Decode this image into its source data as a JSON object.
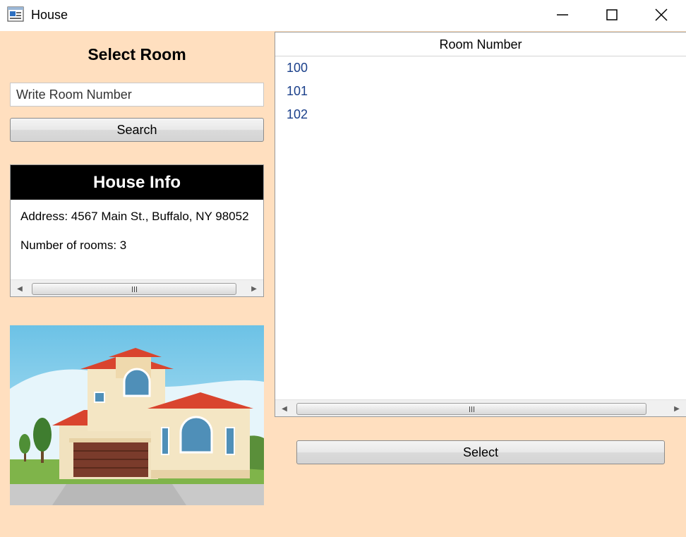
{
  "window": {
    "title": "House",
    "icon": "app-window-icon"
  },
  "left_panel": {
    "heading": "Select Room",
    "search_placeholder": "Write Room Number",
    "search_button": "Search"
  },
  "house_info": {
    "header": "House Info",
    "address": "Address: 4567 Main St., Buffalo, NY 98052",
    "rooms": "Number of rooms: 3"
  },
  "room_list": {
    "column_header": "Room Number",
    "rooms": [
      "100",
      "101",
      "102"
    ]
  },
  "select_button": "Select",
  "colors": {
    "background": "#ffdfbf",
    "list_text": "#1a3f8a",
    "info_header_bg": "#000000"
  }
}
